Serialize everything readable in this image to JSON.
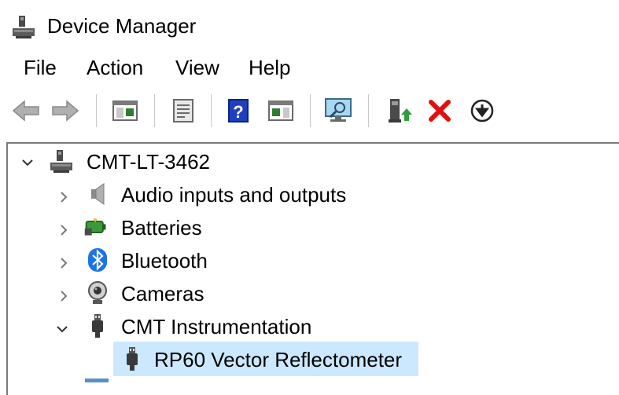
{
  "window": {
    "title": "Device Manager"
  },
  "menu": [
    "File",
    "Action",
    "View",
    "Help"
  ],
  "toolbar": {
    "buttons": [
      {
        "name": "back-button",
        "icon": "arrow-left-icon"
      },
      {
        "name": "forward-button",
        "icon": "arrow-right-icon"
      },
      {
        "name": "show-hide-console-tree-button",
        "icon": "console-tree-icon"
      },
      {
        "name": "properties-button",
        "icon": "properties-icon"
      },
      {
        "name": "help-button",
        "icon": "help-icon",
        "glyph": "?"
      },
      {
        "name": "show-action-pane-button",
        "icon": "action-pane-icon"
      },
      {
        "name": "scan-hardware-button",
        "icon": "monitor-scan-icon"
      },
      {
        "name": "update-driver-button",
        "icon": "update-driver-icon"
      },
      {
        "name": "uninstall-device-button",
        "icon": "red-x-icon"
      },
      {
        "name": "disable-device-button",
        "icon": "circle-down-arrow-icon"
      }
    ]
  },
  "tree": {
    "root": {
      "label": "CMT-LT-3462",
      "expanded": true,
      "icon": "computer-icon"
    },
    "children": [
      {
        "label": "Audio inputs and outputs",
        "expanded": false,
        "icon": "speaker-icon"
      },
      {
        "label": "Batteries",
        "expanded": false,
        "icon": "battery-icon"
      },
      {
        "label": "Bluetooth",
        "expanded": false,
        "icon": "bluetooth-icon"
      },
      {
        "label": "Cameras",
        "expanded": false,
        "icon": "webcam-icon"
      },
      {
        "label": "CMT Instrumentation",
        "expanded": true,
        "icon": "usb-plug-icon",
        "children": [
          {
            "label": "RP60 Vector Reflectometer",
            "selected": true,
            "icon": "usb-plug-icon"
          }
        ]
      }
    ]
  },
  "colors": {
    "selection": "#cce8ff",
    "help_blue": "#1f3fbf",
    "delete_red": "#e01010",
    "bluetooth_blue": "#1a73e8"
  }
}
